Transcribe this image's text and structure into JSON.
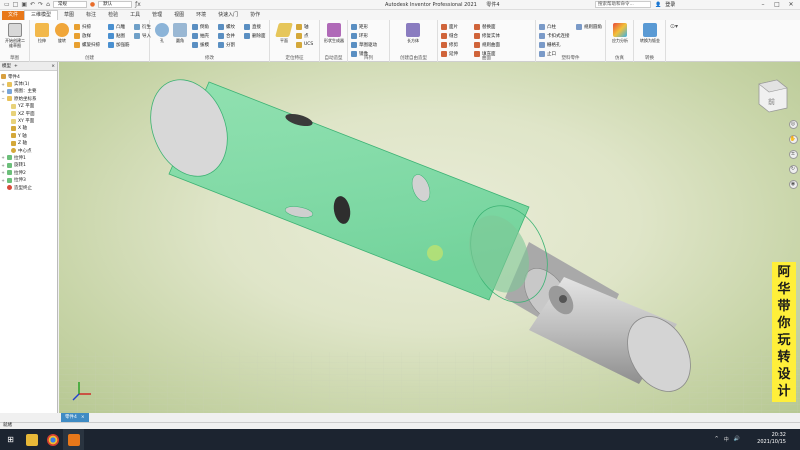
{
  "title_bar": {
    "title": "Autodesk Inventor Professional 2021",
    "doc_name": "零件4",
    "quick_access_combo": "常规",
    "material_combo": "默认",
    "search_placeholder": "搜索帮助和命令...",
    "sign_in": "登录",
    "quick_icons": [
      "folder-icon",
      "new-icon",
      "save-icon",
      "undo-icon",
      "redo-icon",
      "home-icon"
    ]
  },
  "tabs": [
    "文件",
    "三维模型",
    "草图",
    "标注",
    "检验",
    "工具",
    "管理",
    "视图",
    "环境",
    "快速入门",
    "协作"
  ],
  "ribbon": {
    "groups": [
      {
        "label": "草图",
        "buttons": [
          "开始创建二维草图"
        ]
      },
      {
        "label": "创建",
        "buttons": [
          "拉伸",
          "旋转",
          "扫掠",
          "放样",
          "螺旋扫掠",
          "凸雕",
          "贴图",
          "加强筋",
          "衍生",
          "导入"
        ]
      },
      {
        "label": "修改",
        "buttons": [
          "孔",
          "圆角",
          "倒角",
          "抽壳",
          "拔模",
          "螺纹",
          "合并",
          "分割",
          "直接",
          "删除面"
        ]
      },
      {
        "label": "定位特征",
        "buttons": [
          "平面",
          "轴",
          "点",
          "UCS"
        ]
      },
      {
        "label": "自动造型",
        "buttons": [
          "形状生成器"
        ]
      },
      {
        "label": "阵列",
        "buttons": [
          "矩形",
          "环形",
          "草图驱动",
          "镜像"
        ]
      },
      {
        "label": "创建自由造型",
        "buttons": [
          "长方体"
        ]
      },
      {
        "label": "曲面",
        "buttons": [
          "面片",
          "缝合",
          "修剪",
          "延伸",
          "替换面",
          "修复实体",
          "规则曲面",
          "填充面"
        ]
      },
      {
        "label": "塑料零件",
        "buttons": [
          "凸柱",
          "卡扣式连接",
          "栅格孔",
          "止口",
          "规则圆角"
        ]
      },
      {
        "label": "仿真",
        "buttons": [
          "应力分析"
        ]
      },
      {
        "label": "转换",
        "buttons": [
          "转换为钣金"
        ]
      }
    ]
  },
  "browser": {
    "tabs": [
      "模型",
      "+"
    ],
    "items": [
      {
        "label": "零件4",
        "level": 0
      },
      {
        "label": "实体(1)",
        "level": 1
      },
      {
        "label": "视图：主要",
        "level": 1
      },
      {
        "label": "原始坐标系",
        "level": 1
      },
      {
        "label": "YZ 平面",
        "level": 2
      },
      {
        "label": "XZ 平面",
        "level": 2
      },
      {
        "label": "XY 平面",
        "level": 2
      },
      {
        "label": "X 轴",
        "level": 2
      },
      {
        "label": "Y 轴",
        "level": 2
      },
      {
        "label": "Z 轴",
        "level": 2
      },
      {
        "label": "中心点",
        "level": 2
      },
      {
        "label": "拉伸1",
        "level": 1
      },
      {
        "label": "旋转1",
        "level": 1
      },
      {
        "label": "拉伸2",
        "level": 1
      },
      {
        "label": "拉伸3",
        "level": 1
      },
      {
        "label": "造型终止",
        "level": 1
      }
    ]
  },
  "doc_tab": {
    "label": "零件4",
    "close": "×"
  },
  "status_bar": {
    "text": "就绪"
  },
  "watermark": {
    "chars": [
      "阿",
      "华",
      "带",
      "你",
      "玩",
      "转",
      "设",
      "计"
    ]
  },
  "taskbar": {
    "time": "20:32",
    "date": "2021/10/15",
    "tray": [
      "^",
      "中",
      "🔊"
    ]
  },
  "viewcube_label": "前",
  "colors": {
    "accent": "#e8781a",
    "shell": "#6cd9a0",
    "steel": "#b8b8b8"
  }
}
